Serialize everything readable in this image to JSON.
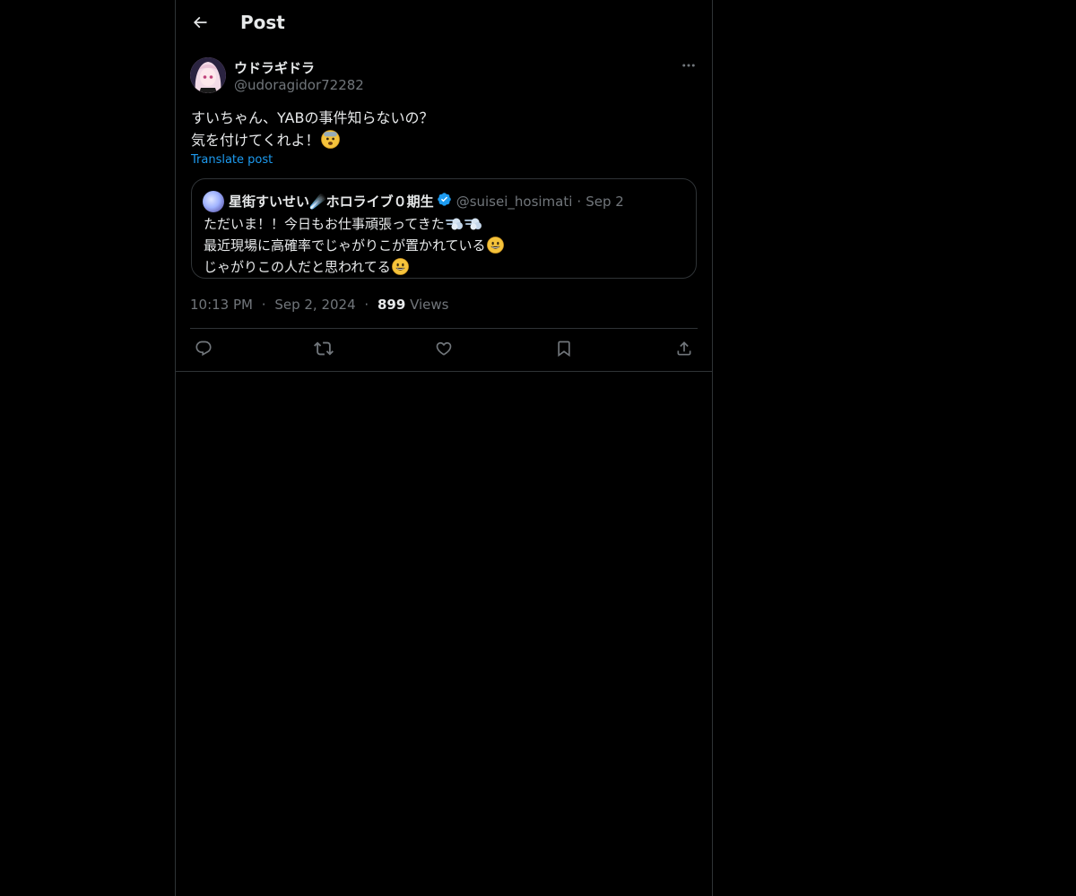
{
  "header": {
    "title": "Post"
  },
  "post": {
    "author_name": "ウドラギドラ",
    "author_handle": "@udoragidor72282",
    "text_line1": "すいちゃん、YABの事件知らないの？",
    "text_line2": "気を付けてくれよ！",
    "text_line2_emoji": "anxious-face-emoji",
    "translate_label": "Translate post",
    "time": "10:13 PM",
    "date": "Sep 2, 2024",
    "separator": "·",
    "views_count": "899",
    "views_label": "Views"
  },
  "quote": {
    "author_name": "星街すいせい☄️ホロライブ０期生",
    "author_handle": "@suisei_hosimati",
    "date": "Sep 2",
    "separator": "·",
    "line1": "ただいま！！今日もお仕事頑張ってきた",
    "line1_emoji": "dash-emoji",
    "line2": "最近現場に高確率でじゃがりこが置かれている",
    "line2_emoji": "grinning-face-emoji",
    "line3": "じゃがりこの人だと思われてる",
    "line3_emoji": "grinning-face-emoji"
  },
  "actions": {
    "reply_icon": "reply-icon",
    "repost_icon": "repost-icon",
    "like_icon": "heart-icon",
    "bookmark_icon": "bookmark-icon",
    "share_icon": "share-icon"
  },
  "colors": {
    "background": "#000000",
    "text": "#e7e9ea",
    "muted": "#71767b",
    "accent": "#1d9bf0",
    "border": "#2f3336"
  }
}
